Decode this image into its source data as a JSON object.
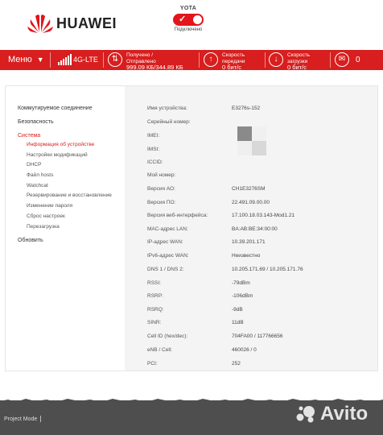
{
  "header": {
    "brand": "HUAWEI",
    "operator": "YOTA",
    "connection_status": "Подключено",
    "colors": {
      "accent": "#d81e1e",
      "toggle": "#e3141b"
    }
  },
  "statusbar": {
    "menu_label": "Меню",
    "network": "4G-LTE",
    "traffic_label_1": "Получено /",
    "traffic_label_2": "Отправлено",
    "traffic_value": "999.09 КБ/344.89 КБ",
    "upload_label_1": "Скорость",
    "upload_label_2": "передачи",
    "upload_value": "0 бит/с",
    "download_label_1": "Скорость",
    "download_label_2": "загрузки",
    "download_value": "0 бит/с",
    "messages_count": "0"
  },
  "sidebar": {
    "groups": [
      {
        "label": "Коммутируемое соединение"
      },
      {
        "label": "Безопасность"
      },
      {
        "label": "Система"
      }
    ],
    "system_items": [
      {
        "label": "Информация об устройстве"
      },
      {
        "label": "Настройки модификаций"
      },
      {
        "label": "DHCP"
      },
      {
        "label": "Файл hosts"
      },
      {
        "label": "Watchcat"
      },
      {
        "label": "Резервирование и восстановление"
      },
      {
        "label": "Изменение пароля"
      },
      {
        "label": "Сброс настроек"
      },
      {
        "label": "Перезагрузка"
      }
    ],
    "update_label": "Обновить"
  },
  "device_info": [
    {
      "key": "Имя устройства:",
      "value": "E3276s-152"
    },
    {
      "key": "Серийный номер:",
      "value": ""
    },
    {
      "key": "IMEI:",
      "value": ""
    },
    {
      "key": "IMSI:",
      "value": ""
    },
    {
      "key": "ICCID:",
      "value": ""
    },
    {
      "key": "Мой номер:",
      "value": ""
    },
    {
      "key": "Версия АО:",
      "value": "CH1E3276SM"
    },
    {
      "key": "Версия ПО:",
      "value": "22.491.09.00.00"
    },
    {
      "key": "Версия веб-интерфейса:",
      "value": "17.100.18.03.143-Mod1.21"
    },
    {
      "key": "MAC-адрес LAN:",
      "value": "BA:AB:BE:34:00:00"
    },
    {
      "key": "IP-адрес WAN:",
      "value": "10.39.201.171"
    },
    {
      "key": "IPv6-адрес WAN:",
      "value": "Неизвестно"
    },
    {
      "key": "DNS 1 / DNS 2:",
      "value": "10.205.171.69 / 10.205.171.76"
    },
    {
      "key": "RSSI:",
      "value": "-79dBm"
    },
    {
      "key": "RSRP:",
      "value": "-106dBm"
    },
    {
      "key": "RSRQ:",
      "value": "-9dB"
    },
    {
      "key": "SINR:",
      "value": "11dB"
    },
    {
      "key": "Cell ID (hex/dec):",
      "value": "704FA00 / 117766656"
    },
    {
      "key": "eNB / Cell:",
      "value": "460026 / 0"
    },
    {
      "key": "PCI:",
      "value": "252"
    }
  ],
  "footer": {
    "project_mode": "Project Mode",
    "watermark": "Avito"
  }
}
